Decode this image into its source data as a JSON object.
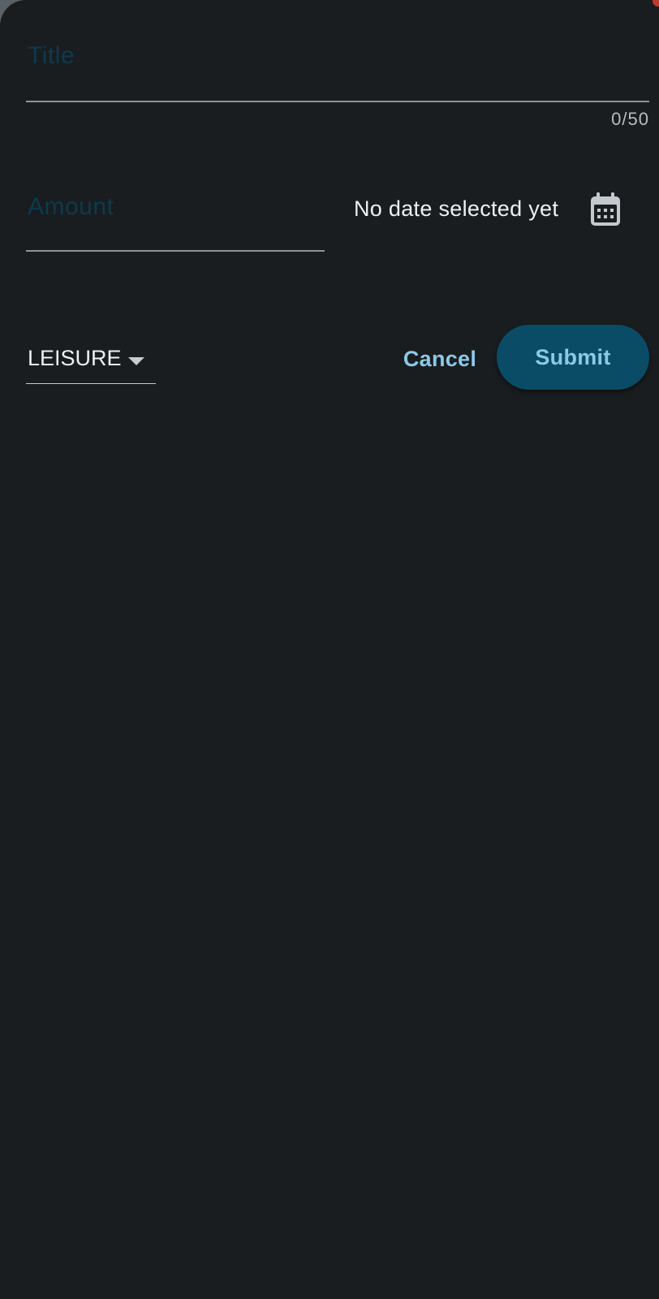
{
  "form": {
    "title_field": {
      "placeholder": "Title",
      "value": "",
      "counter": "0/50"
    },
    "amount_field": {
      "placeholder": "Amount",
      "value": ""
    },
    "date": {
      "text": "No date selected yet",
      "icon": "calendar-icon"
    },
    "category": {
      "selected": "LEISURE",
      "icon": "arrow-drop-down-icon"
    },
    "actions": {
      "cancel_label": "Cancel",
      "submit_label": "Submit"
    }
  },
  "colors": {
    "background": "#191d20",
    "accent": "#8cc9e6",
    "submit_bg": "#0a4c66",
    "placeholder": "#0d3a4d",
    "text": "#eef1f3"
  }
}
